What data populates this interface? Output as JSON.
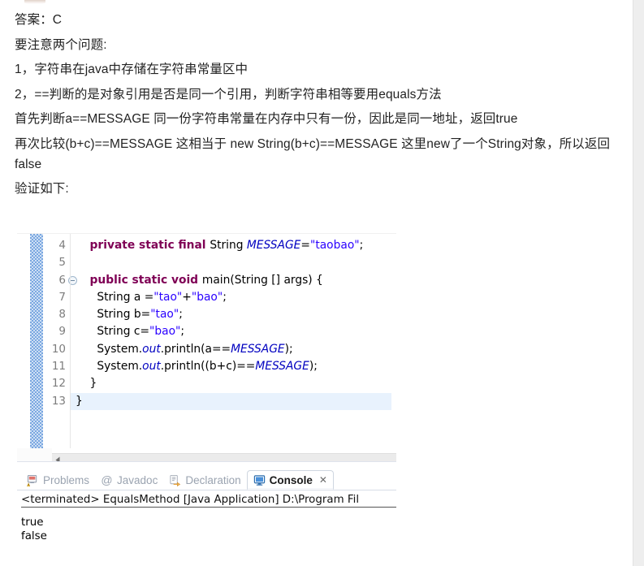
{
  "article": {
    "paragraphs": [
      "答案：C",
      "要注意两个问题:",
      "1，字符串在java中存储在字符串常量区中",
      "2，==判断的是对象引用是否是同一个引用，判断字符串相等要用equals方法",
      "首先判断a==MESSAGE 同一份字符串常量在内存中只有一份，因此是同一地址，返回true",
      "再次比较(b+c)==MESSAGE 这相当于 new String(b+c)==MESSAGE 这里new了一个String对象，所以返回false",
      "验证如下:"
    ]
  },
  "editor": {
    "line_numbers": [
      "4",
      "5",
      "6",
      "7",
      "8",
      "9",
      "10",
      "11",
      "12",
      "13"
    ],
    "fold_marker_line": "6",
    "current_line": "13",
    "lines": [
      {
        "n": "4",
        "tokens": [
          {
            "t": "    ",
            "c": "plain"
          },
          {
            "t": "private static final ",
            "c": "kw"
          },
          {
            "t": "String ",
            "c": "plain"
          },
          {
            "t": "MESSAGE",
            "c": "fld"
          },
          {
            "t": "=",
            "c": "plain"
          },
          {
            "t": "\"taobao\"",
            "c": "str"
          },
          {
            "t": ";",
            "c": "plain"
          }
        ]
      },
      {
        "n": "5",
        "tokens": [
          {
            "t": "",
            "c": "plain"
          }
        ]
      },
      {
        "n": "6",
        "tokens": [
          {
            "t": "    ",
            "c": "plain"
          },
          {
            "t": "public static void ",
            "c": "kw"
          },
          {
            "t": "main(String [] args) {",
            "c": "plain"
          }
        ]
      },
      {
        "n": "7",
        "tokens": [
          {
            "t": "      String a =",
            "c": "plain"
          },
          {
            "t": "\"tao\"",
            "c": "str"
          },
          {
            "t": "+",
            "c": "plain"
          },
          {
            "t": "\"bao\"",
            "c": "str"
          },
          {
            "t": ";",
            "c": "plain"
          }
        ]
      },
      {
        "n": "8",
        "tokens": [
          {
            "t": "      String b=",
            "c": "plain"
          },
          {
            "t": "\"tao\"",
            "c": "str"
          },
          {
            "t": ";",
            "c": "plain"
          }
        ]
      },
      {
        "n": "9",
        "tokens": [
          {
            "t": "      String c=",
            "c": "plain"
          },
          {
            "t": "\"bao\"",
            "c": "str"
          },
          {
            "t": ";",
            "c": "plain"
          }
        ]
      },
      {
        "n": "10",
        "tokens": [
          {
            "t": "      System.",
            "c": "plain"
          },
          {
            "t": "out",
            "c": "fld"
          },
          {
            "t": ".println(a==",
            "c": "plain"
          },
          {
            "t": "MESSAGE",
            "c": "fld"
          },
          {
            "t": ");",
            "c": "plain"
          }
        ]
      },
      {
        "n": "11",
        "tokens": [
          {
            "t": "      System.",
            "c": "plain"
          },
          {
            "t": "out",
            "c": "fld"
          },
          {
            "t": ".println((b+c)==",
            "c": "plain"
          },
          {
            "t": "MESSAGE",
            "c": "fld"
          },
          {
            "t": ");",
            "c": "plain"
          }
        ]
      },
      {
        "n": "12",
        "tokens": [
          {
            "t": "    }",
            "c": "plain"
          }
        ]
      },
      {
        "n": "13",
        "tokens": [
          {
            "t": "}",
            "c": "plain"
          }
        ]
      }
    ]
  },
  "views": {
    "tabs": [
      {
        "label": "Problems",
        "icon": "problems-icon",
        "active": false
      },
      {
        "label": "Javadoc",
        "icon": "javadoc-at-icon",
        "active": false
      },
      {
        "label": "Declaration",
        "icon": "declaration-icon",
        "active": false
      },
      {
        "label": "Console",
        "icon": "console-icon",
        "active": true,
        "close_glyph": "✕"
      }
    ]
  },
  "console": {
    "header": "<terminated> EqualsMethod [Java Application] D:\\Program Fil",
    "output_lines": [
      "true",
      "false"
    ]
  },
  "colors": {
    "keyword": "#7f0055",
    "string": "#2a00ff",
    "field": "#0000c0",
    "current_line_highlight": "#e8f2fd",
    "annotation_ruler": "#7aa7e0",
    "tab_inactive_text": "#9aa3b0",
    "right_rail": "#eeeeee"
  },
  "scrollbar": {
    "left_arrow_glyph": "◀"
  }
}
